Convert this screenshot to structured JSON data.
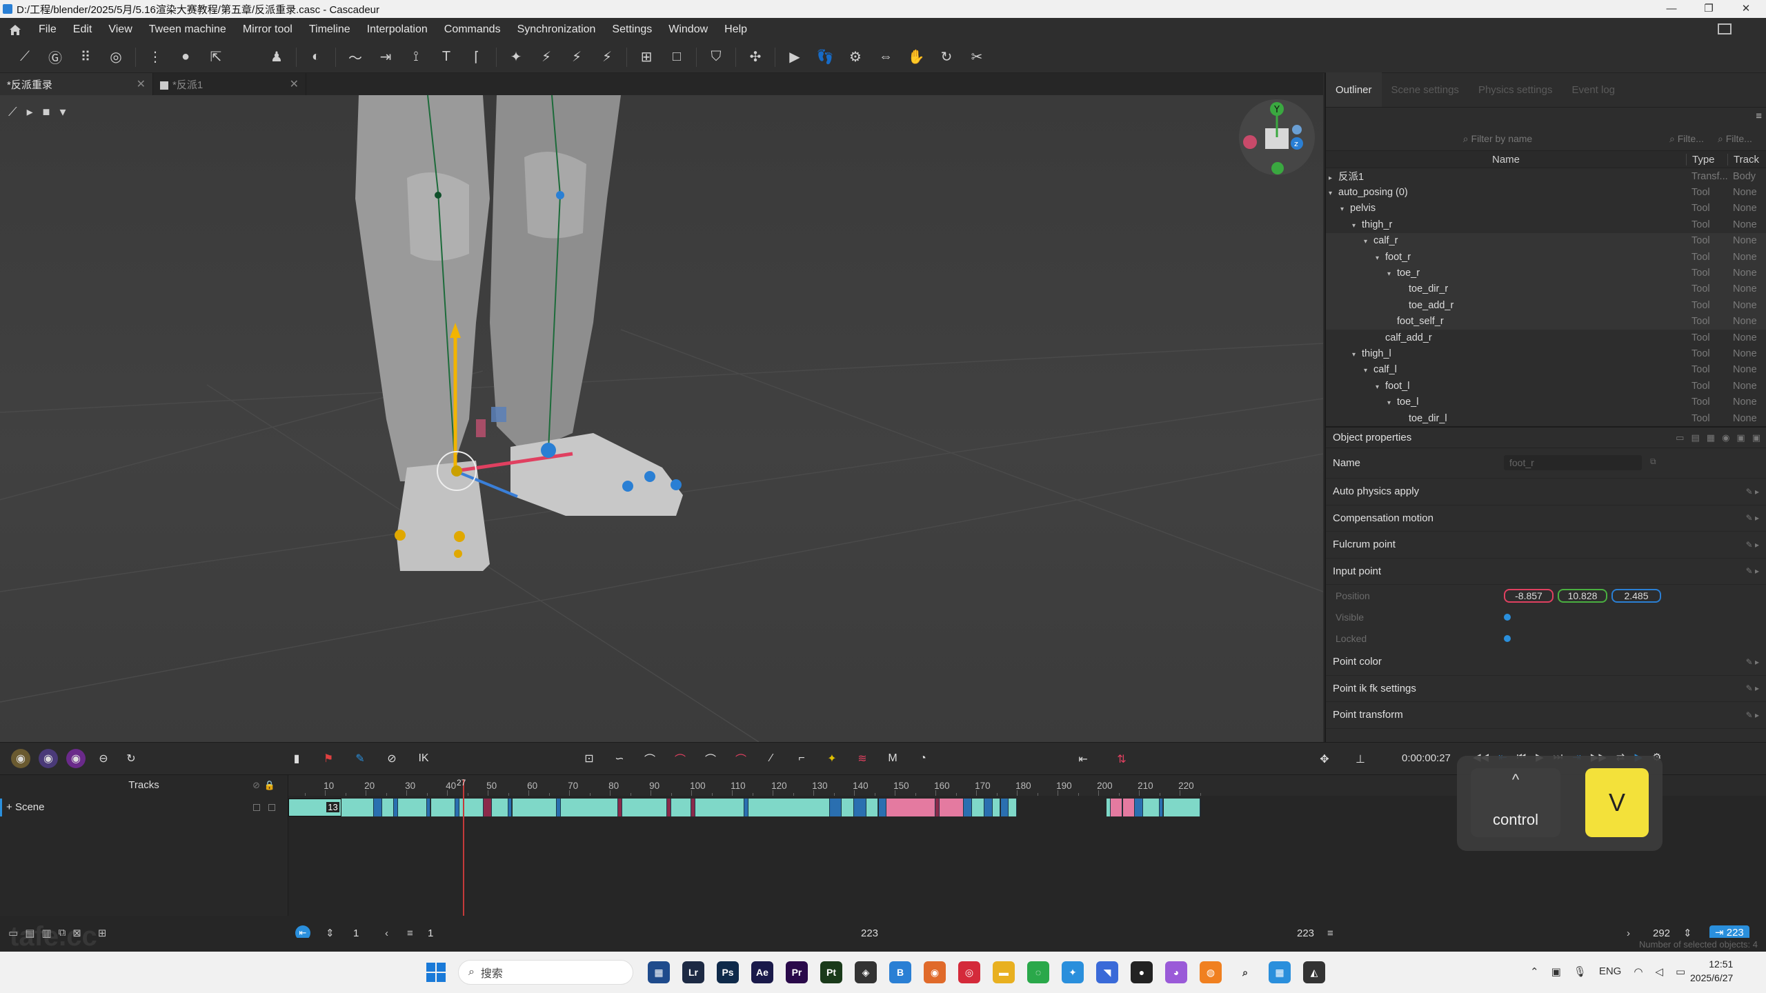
{
  "titlebar": {
    "title": "D:/工程/blender/2025/5月/5.16渲染大赛教程/第五章/反派重录.casc - Cascadeur",
    "min": "—",
    "max": "❐",
    "close": "✕"
  },
  "menu": [
    "File",
    "Edit",
    "View",
    "Tween machine",
    "Mirror tool",
    "Timeline",
    "Interpolation",
    "Commands",
    "Synchronization",
    "Settings",
    "Window",
    "Help"
  ],
  "tabs": [
    {
      "label": "*反派重录",
      "close": "✕"
    },
    {
      "label": "*反派1",
      "close": "✕"
    }
  ],
  "outliner": {
    "tabs": [
      "Outliner",
      "Scene settings",
      "Physics settings",
      "Event log"
    ],
    "filter_placeholder": "Filter by name",
    "filter2": "Filte...",
    "filter3": "Filte...",
    "col_name": "Name",
    "col_type": "Type",
    "col_track": "Track",
    "rows": [
      {
        "name": "反派1",
        "type": "Transf...",
        "track": "Body",
        "indent": 0,
        "arrow": "▸"
      },
      {
        "name": "auto_posing (0)",
        "type": "Tool",
        "track": "None",
        "indent": 0,
        "arrow": "▾"
      },
      {
        "name": "pelvis",
        "type": "Tool",
        "track": "None",
        "indent": 1,
        "arrow": "▾"
      },
      {
        "name": "thigh_r",
        "type": "Tool",
        "track": "None",
        "indent": 2,
        "arrow": "▾"
      },
      {
        "name": "calf_r",
        "type": "Tool",
        "track": "None",
        "indent": 3,
        "arrow": "▾"
      },
      {
        "name": "foot_r",
        "type": "Tool",
        "track": "None",
        "indent": 4,
        "arrow": "▾"
      },
      {
        "name": "toe_r",
        "type": "Tool",
        "track": "None",
        "indent": 5,
        "arrow": "▾"
      },
      {
        "name": "toe_dir_r",
        "type": "Tool",
        "track": "None",
        "indent": 6,
        "arrow": ""
      },
      {
        "name": "toe_add_r",
        "type": "Tool",
        "track": "None",
        "indent": 6,
        "arrow": ""
      },
      {
        "name": "foot_self_r",
        "type": "Tool",
        "track": "None",
        "indent": 5,
        "arrow": ""
      },
      {
        "name": "calf_add_r",
        "type": "Tool",
        "track": "None",
        "indent": 4,
        "arrow": ""
      },
      {
        "name": "thigh_l",
        "type": "Tool",
        "track": "None",
        "indent": 2,
        "arrow": "▾"
      },
      {
        "name": "calf_l",
        "type": "Tool",
        "track": "None",
        "indent": 3,
        "arrow": "▾"
      },
      {
        "name": "foot_l",
        "type": "Tool",
        "track": "None",
        "indent": 4,
        "arrow": "▾"
      },
      {
        "name": "toe_l",
        "type": "Tool",
        "track": "None",
        "indent": 5,
        "arrow": "▾"
      },
      {
        "name": "toe_dir_l",
        "type": "Tool",
        "track": "None",
        "indent": 6,
        "arrow": ""
      }
    ]
  },
  "objprops": {
    "title": "Object properties",
    "name_label": "Name",
    "name_value": "foot_r",
    "sections": [
      "Auto physics apply",
      "Compensation motion",
      "Fulcrum point",
      "Input point"
    ],
    "position_label": "Position",
    "pos_x": "-8.857",
    "pos_y": "10.828",
    "pos_z": "2.485",
    "visible_label": "Visible",
    "locked_label": "Locked",
    "sections2": [
      "Point color",
      "Point ik fk settings",
      "Point transform"
    ]
  },
  "timeline": {
    "time": "0:00:00:27",
    "tracks_label": "Tracks",
    "scene_label": "Scene",
    "current_frame": "27",
    "segment_label": "13",
    "ticks": [
      "10",
      "20",
      "30",
      "40",
      "50",
      "60",
      "70",
      "80",
      "90",
      "100",
      "110",
      "120",
      "130",
      "140",
      "150",
      "160",
      "170",
      "180",
      "190",
      "200",
      "210",
      "220"
    ],
    "start": "1",
    "start2": "1",
    "mid": "223",
    "end": "223",
    "total": "292",
    "end_badge": "223",
    "status": "Number of selected objects: 4"
  },
  "key_overlay": {
    "modifier": "control",
    "key": "V",
    "caret": "^"
  },
  "taskbar": {
    "search": "搜索",
    "lang": "ENG",
    "time": "12:51",
    "date": "2025/6/27"
  },
  "watermark": "tafe.cc",
  "colors": {
    "accent": "#2a8fdc",
    "track_teal": "#7fd8c8",
    "track_pink": "#e47aa0",
    "track_blue": "#2a6fb0",
    "key_yellow": "#f3e13a"
  }
}
